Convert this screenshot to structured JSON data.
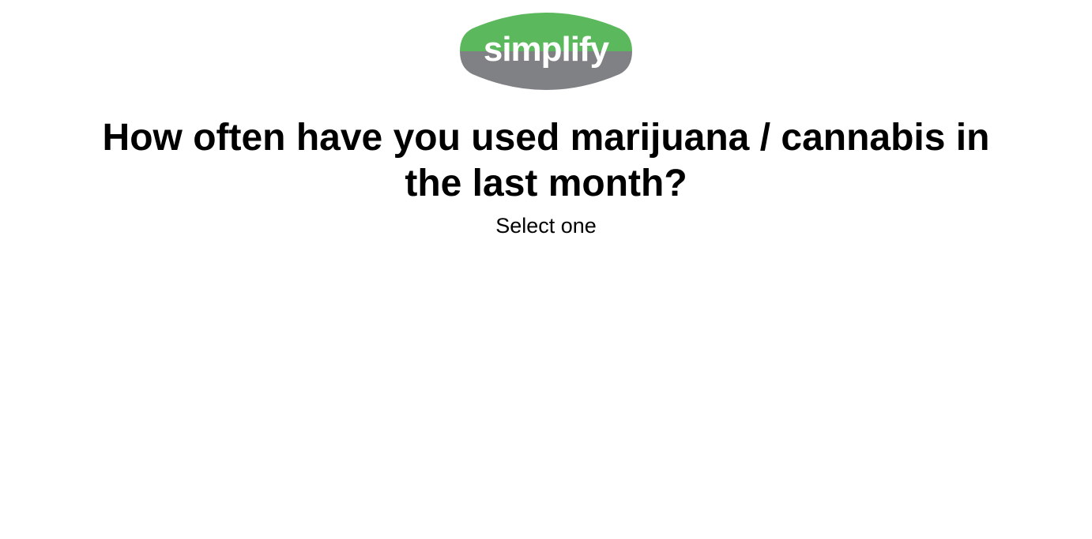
{
  "logo": {
    "text": "simplify",
    "colors": {
      "top": "#5cb85c",
      "bottom": "#808184",
      "text": "#ffffff"
    }
  },
  "question": {
    "title": "How often have you used marijuana / cannabis in the last month?",
    "instruction": "Select one"
  }
}
